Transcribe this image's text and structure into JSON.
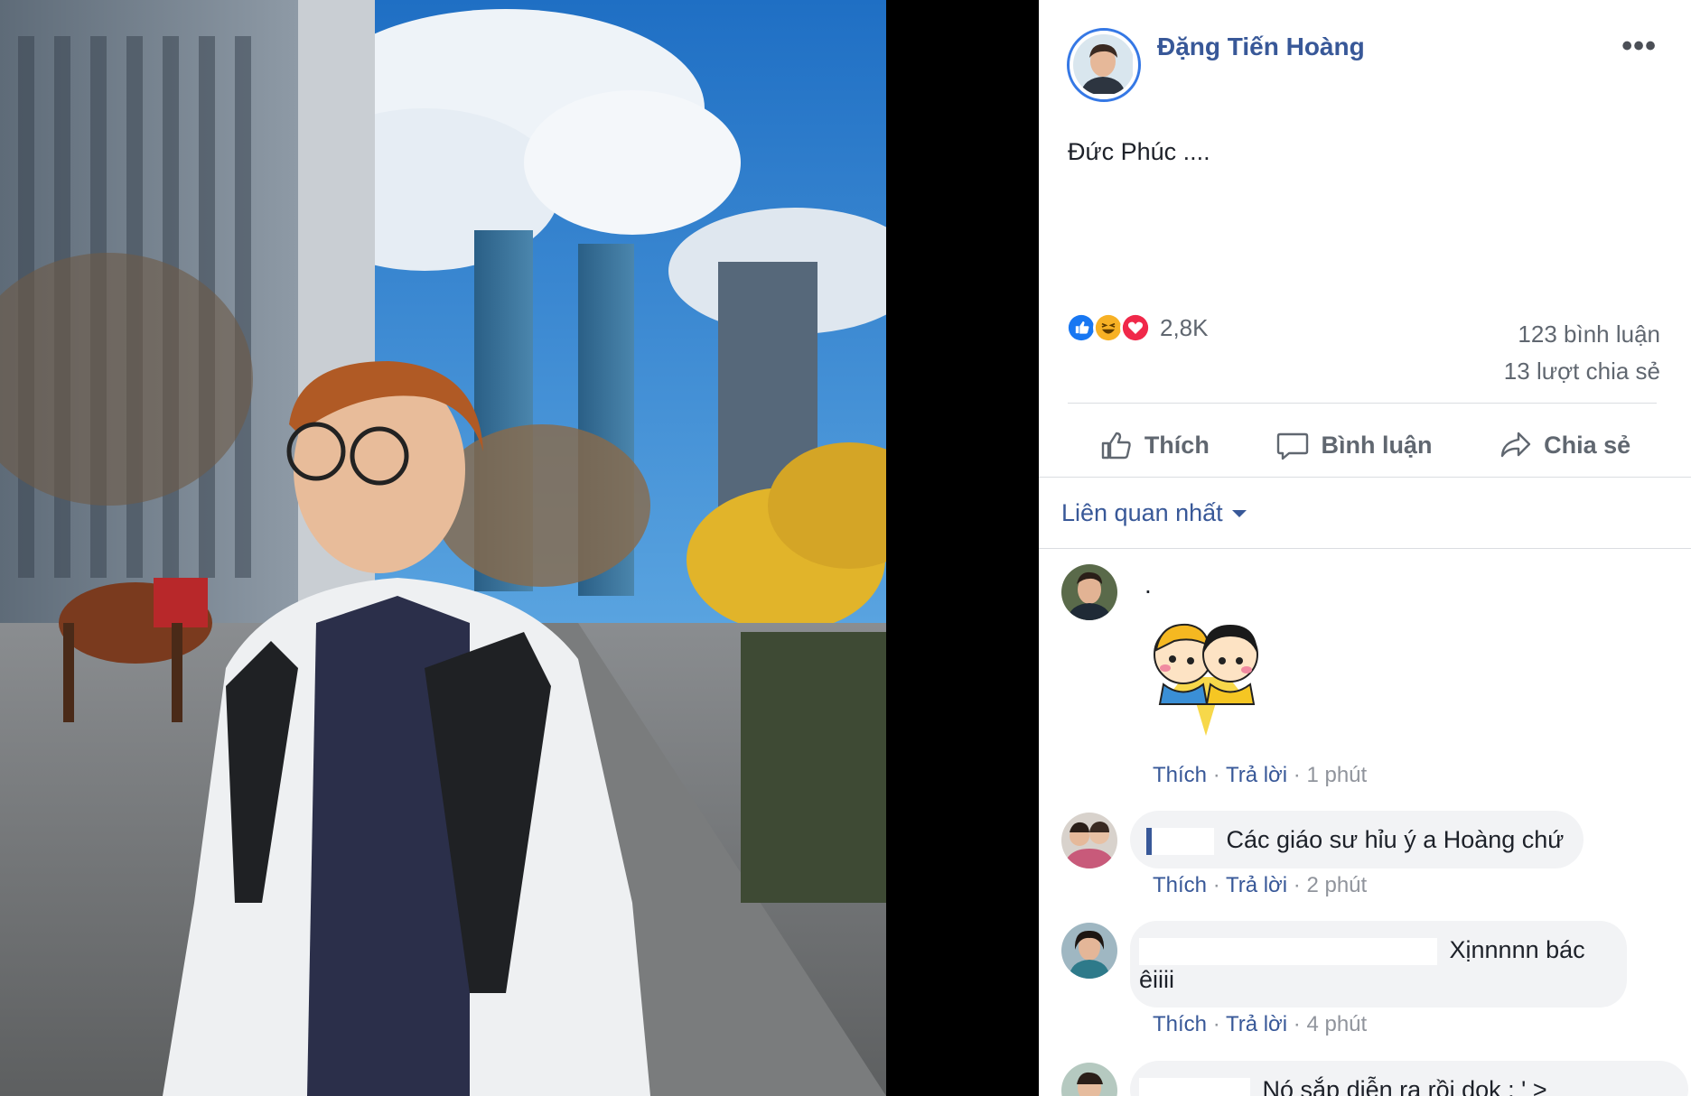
{
  "post": {
    "author": "Đặng Tiến Hoàng",
    "more_label": "•••",
    "text": "Đức Phúc ....",
    "reaction_count": "2,8K",
    "comments_count": "123 bình luận",
    "shares_count": "13 lượt chia sẻ",
    "reaction_icons": [
      "like-icon",
      "haha-icon",
      "love-icon"
    ]
  },
  "actions": {
    "like": "Thích",
    "comment": "Bình luận",
    "share": "Chia sẻ"
  },
  "sort": {
    "label": "Liên quan nhất"
  },
  "comments": [
    {
      "text": ".",
      "has_sticker": true,
      "like": "Thích",
      "reply": "Trả lời",
      "time": "1 phút"
    },
    {
      "author_visible": "I",
      "text": "Các giáo sư hỉu ý a Hoàng chứ",
      "like": "Thích",
      "reply": "Trả lời",
      "time": "2 phút"
    },
    {
      "text_line1": "Xịnnnnn bác",
      "text_line2": "êiiii",
      "like": "Thích",
      "reply": "Trả lời",
      "time": "4 phút"
    },
    {
      "text": "Nó sắp diễn ra rồi dọk : ' >"
    }
  ],
  "separator": "·",
  "colors": {
    "link": "#385898",
    "avatar_ring": "#3578e5",
    "muted": "#606770",
    "bubble": "#f2f3f5"
  }
}
